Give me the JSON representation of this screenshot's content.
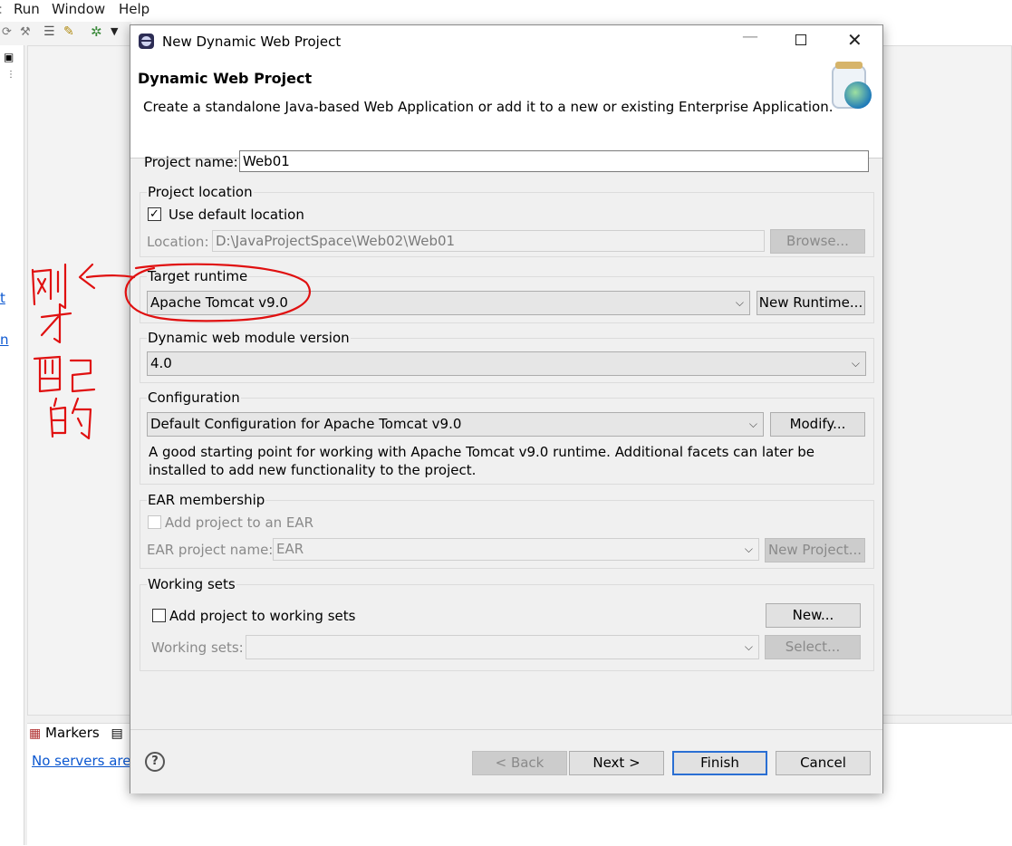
{
  "ide": {
    "menu": [
      "Run",
      "Window",
      "Help"
    ],
    "markers_tab": "Markers",
    "servers_link": "No servers are"
  },
  "dialog": {
    "title": "New Dynamic Web Project",
    "header_title": "Dynamic Web Project",
    "header_desc": "Create a standalone Java-based Web Application or add it to a new or existing Enterprise Application.",
    "project_name_label": "Project name:",
    "project_name_value": "Web01",
    "project_location": {
      "group_label": "Project location",
      "use_default_label": "Use default location",
      "use_default_checked": true,
      "location_label": "Location:",
      "location_value": "D:\\JavaProjectSpace\\Web02\\Web01",
      "browse_label": "Browse..."
    },
    "target_runtime": {
      "group_label": "Target runtime",
      "selected": "Apache Tomcat v9.0",
      "new_runtime_label": "New Runtime..."
    },
    "module_version": {
      "group_label": "Dynamic web module version",
      "selected": "4.0"
    },
    "configuration": {
      "group_label": "Configuration",
      "selected": "Default Configuration for Apache Tomcat v9.0",
      "modify_label": "Modify...",
      "description": "A good starting point for working with Apache Tomcat v9.0 runtime. Additional facets can later be installed to add new functionality to the project."
    },
    "ear": {
      "group_label": "EAR membership",
      "add_label": "Add project to an EAR",
      "name_label": "EAR project name:",
      "name_value": "EAR",
      "new_project_label": "New Project..."
    },
    "working_sets": {
      "group_label": "Working sets",
      "add_label": "Add project to working sets",
      "new_label": "New...",
      "sets_label": "Working sets:",
      "select_label": "Select..."
    },
    "buttons": {
      "back": "< Back",
      "next": "Next >",
      "finish": "Finish",
      "cancel": "Cancel"
    }
  },
  "annotation": {
    "handwritten_text": "刚才配的",
    "color": "#e01010"
  }
}
